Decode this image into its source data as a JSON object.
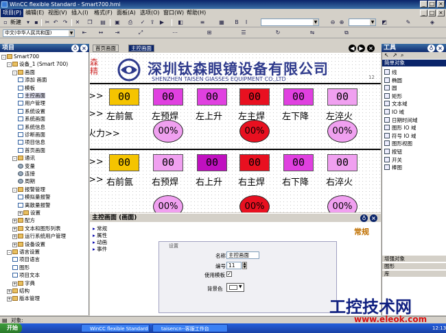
{
  "window": {
    "title": "WinCC flexible Standard - Smart700.hmi"
  },
  "menu": [
    "项目(P)",
    "编辑(E)",
    "视图(V)",
    "插入(I)",
    "格式(F)",
    "面板(A)",
    "选项(O)",
    "窗口(W)",
    "帮助(H)"
  ],
  "toolbar": {
    "new_label": "新建",
    "language": "中文(中华人民共和国)"
  },
  "project_panel": {
    "title": "项目",
    "tree": [
      {
        "label": "Smart700",
        "level": 0,
        "icon": "device",
        "exp": "-"
      },
      {
        "label": "设备_1 (Smart 700)",
        "level": 1,
        "icon": "device",
        "exp": "-"
      },
      {
        "label": "画面",
        "level": 2,
        "icon": "folder",
        "exp": "-"
      },
      {
        "label": "添加 画面",
        "level": 3,
        "icon": "screen"
      },
      {
        "label": "模板",
        "level": 3,
        "icon": "screen"
      },
      {
        "label": "主控画面",
        "level": 3,
        "icon": "screen",
        "selected": true
      },
      {
        "label": "用户管理",
        "level": 3,
        "icon": "screen"
      },
      {
        "label": "系统设置",
        "level": 3,
        "icon": "screen"
      },
      {
        "label": "系统画面",
        "level": 3,
        "icon": "screen"
      },
      {
        "label": "系统信息",
        "level": 3,
        "icon": "screen"
      },
      {
        "label": "诊断画面",
        "level": 3,
        "icon": "screen"
      },
      {
        "label": "项目信息",
        "level": 3,
        "icon": "screen"
      },
      {
        "label": "首页画面",
        "level": 3,
        "icon": "screen"
      },
      {
        "label": "通讯",
        "level": 2,
        "icon": "folder",
        "exp": "-"
      },
      {
        "label": "变量",
        "level": 3,
        "icon": "gear"
      },
      {
        "label": "连接",
        "level": 3,
        "icon": "gear"
      },
      {
        "label": "周期",
        "level": 3,
        "icon": "gear"
      },
      {
        "label": "报警管理",
        "level": 2,
        "icon": "folder",
        "exp": "-"
      },
      {
        "label": "模拟量报警",
        "level": 3,
        "icon": "screen"
      },
      {
        "label": "离散量报警",
        "level": 3,
        "icon": "screen"
      },
      {
        "label": "设置",
        "level": 3,
        "icon": "folder",
        "exp": "+"
      },
      {
        "label": "配方",
        "level": 2,
        "icon": "folder",
        "exp": "+"
      },
      {
        "label": "文本和图形列表",
        "level": 2,
        "icon": "folder",
        "exp": "+"
      },
      {
        "label": "运行系统用户管理",
        "level": 2,
        "icon": "folder",
        "exp": "+"
      },
      {
        "label": "设备设置",
        "level": 2,
        "icon": "folder",
        "exp": "+"
      },
      {
        "label": "语言设置",
        "level": 1,
        "icon": "folder",
        "exp": "-"
      },
      {
        "label": "项目语言",
        "level": 2,
        "icon": "screen"
      },
      {
        "label": "图形",
        "level": 2,
        "icon": "screen"
      },
      {
        "label": "项目文本",
        "level": 2,
        "icon": "screen"
      },
      {
        "label": "字典",
        "level": 2,
        "icon": "folder",
        "exp": "+"
      },
      {
        "label": "结构",
        "level": 1,
        "icon": "folder",
        "exp": "+"
      },
      {
        "label": "版本管理",
        "level": 1,
        "icon": "folder",
        "exp": "+"
      }
    ]
  },
  "tabs": [
    "首页画面",
    "主控画面"
  ],
  "hmi": {
    "logo_cn": "深圳钛森眼镜设备有限公司",
    "logo_en": "SHENZHEN TAISEN GIASSES EQUIPMENT CO.,LTD",
    "logo_side": "森精",
    "arrow": ">>",
    "value": "00",
    "pct": "00%",
    "fire_label": "火力>>",
    "row1": [
      "左前氤",
      "左预焊",
      "左上升",
      "左主焊",
      "左下降",
      "左淬火"
    ],
    "row2": [
      "右前氤",
      "右预焊",
      "右上升",
      "右主焊",
      "右下降",
      "右淬火"
    ],
    "ruler": "12"
  },
  "properties": {
    "title": "主控画面 (画面)",
    "section": "常规",
    "nav": [
      "常规",
      "属性",
      "动画",
      "事件"
    ],
    "group": "设置",
    "name_label": "名称",
    "name_value": "主控画面",
    "number_label": "编号",
    "number_value": "11",
    "template_label": "使用模板",
    "bg_label": "背景色"
  },
  "toolbox": {
    "title": "工具",
    "section": "简单对象",
    "items": [
      "线",
      "椭圆",
      "圆",
      "矩形",
      "文本域",
      "IO 域",
      "日期时间域",
      "图形 IO 域",
      "符号 IO 域",
      "图形视图",
      "按钮",
      "开关",
      "棒图"
    ],
    "sections_bottom": [
      "增强对象",
      "图形",
      "库"
    ]
  },
  "objects_bar": "对象:",
  "taskbar": {
    "start": "开始",
    "tasks": [
      "WinCC flexible Standard ...",
      "taisencn--客服工作台"
    ],
    "clock": "12:13"
  },
  "watermark": {
    "cn": "工控技术网",
    "url": "www.eleok.com"
  },
  "colors": {
    "yellow": "#f5c400",
    "magenta": "#e040e0",
    "pink": "#f0a0f0",
    "red": "#e81020",
    "deep_magenta": "#c010c0"
  }
}
